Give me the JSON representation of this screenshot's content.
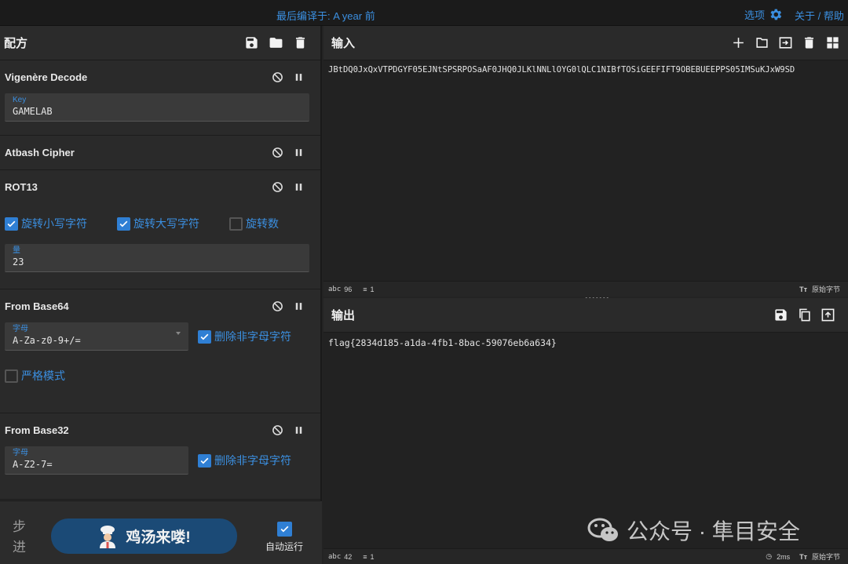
{
  "topbar": {
    "last_build": "最后编译于: A year 前",
    "options_label": "选项",
    "about_label": "关于 / 帮助"
  },
  "recipe": {
    "title": "配方",
    "operations": [
      {
        "name": "Vigenère Decode",
        "key_label": "Key",
        "key_value": "GAMELAB"
      },
      {
        "name": "Atbash Cipher"
      },
      {
        "name": "ROT13",
        "checks": [
          {
            "label": "旋转小写字符",
            "checked": true
          },
          {
            "label": "旋转大写字符",
            "checked": true
          },
          {
            "label": "旋转数",
            "checked": false
          }
        ],
        "amount_label": "量",
        "amount_value": "23"
      },
      {
        "name": "From Base64",
        "alphabet_label": "字母",
        "alphabet_value": "A-Za-z0-9+/=",
        "remove_label": "删除非字母字符",
        "strict_label": "严格模式"
      },
      {
        "name": "From Base32",
        "alphabet_label": "字母",
        "alphabet_value": "A-Z2-7=",
        "remove_label": "删除非字母字符"
      }
    ]
  },
  "input": {
    "title": "输入",
    "text": "JBtDQ0JxQxVTPDGYF05EJNtSPSRPOSaAF0JHQ0JLKlNNLlOYG0lQLC1NIBfTOSiGEEFIFT9OBEBUEEPPS05IMSuKJxW9SD",
    "status_chars": "96",
    "status_lines": "1",
    "status_right": "原始字节"
  },
  "output": {
    "title": "输出",
    "text": "flag{2834d185-a1da-4fb1-8bac-59076eb6a634}",
    "status_chars": "42",
    "status_lines": "1",
    "status_time": "2ms",
    "status_right": "原始字节"
  },
  "controls": {
    "step_label_1": "步",
    "step_label_2": "进",
    "bake_label": "鸡汤来喽!",
    "autorun_label": "自动运行"
  },
  "watermark": "公众号 · 隼目安全",
  "colors": {
    "accent": "#3b8fe0",
    "bake": "#1b4a76",
    "checkbox": "#2f7fd4"
  }
}
